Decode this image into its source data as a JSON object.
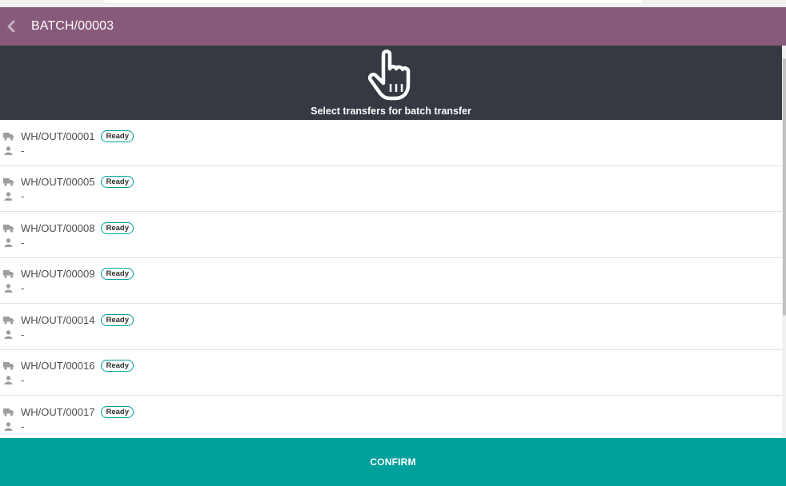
{
  "header": {
    "title": "BATCH/00003",
    "back_icon": "chevron-left-icon"
  },
  "banner": {
    "icon": "pointing-hand-icon",
    "caption": "Select transfers for batch transfer"
  },
  "transfers": [
    {
      "reference": "WH/OUT/00001",
      "status": "Ready",
      "partner": "-"
    },
    {
      "reference": "WH/OUT/00005",
      "status": "Ready",
      "partner": "-"
    },
    {
      "reference": "WH/OUT/00008",
      "status": "Ready",
      "partner": "-"
    },
    {
      "reference": "WH/OUT/00009",
      "status": "Ready",
      "partner": "-"
    },
    {
      "reference": "WH/OUT/00014",
      "status": "Ready",
      "partner": "-"
    },
    {
      "reference": "WH/OUT/00016",
      "status": "Ready",
      "partner": "-"
    },
    {
      "reference": "WH/OUT/00017",
      "status": "Ready",
      "partner": "-"
    }
  ],
  "row_icons": {
    "transfer": "truck-icon",
    "partner": "user-icon"
  },
  "footer": {
    "confirm_label": "CONFIRM"
  },
  "colors": {
    "header_bg": "#875a7b",
    "banner_bg": "#353a42",
    "accent": "#00a09d"
  }
}
